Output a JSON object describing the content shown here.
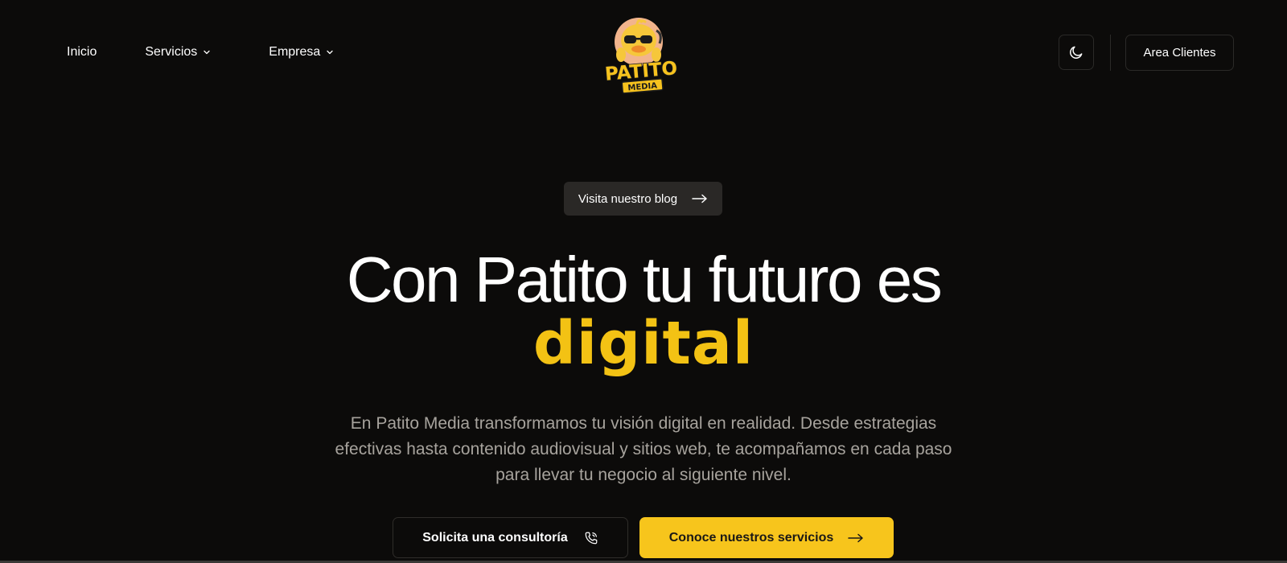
{
  "header": {
    "nav": {
      "inicio": "Inicio",
      "servicios": "Servicios",
      "empresa": "Empresa"
    },
    "logo": {
      "line1": "PATITO",
      "line2": "MEDIA"
    },
    "theme_toggle_icon": "moon-icon",
    "area_clientes": "Area Clientes"
  },
  "hero": {
    "blog_link": "Visita nuestro blog",
    "headline": "Con Patito tu futuro es",
    "headline_accent": "digital",
    "intro": "En Patito Media transformamos tu visión digital en realidad. Desde estrategias efectivas hasta contenido audiovisual y sitios web, te acompañamos en cada paso para llevar tu negocio al siguiente nivel.",
    "cta_primary": "Solicita una consultoría",
    "cta_secondary": "Conoce nuestros servicios"
  },
  "colors": {
    "background": "#0c0b0a",
    "accent": "#f7c51c",
    "muted_text": "#a7a39d"
  }
}
